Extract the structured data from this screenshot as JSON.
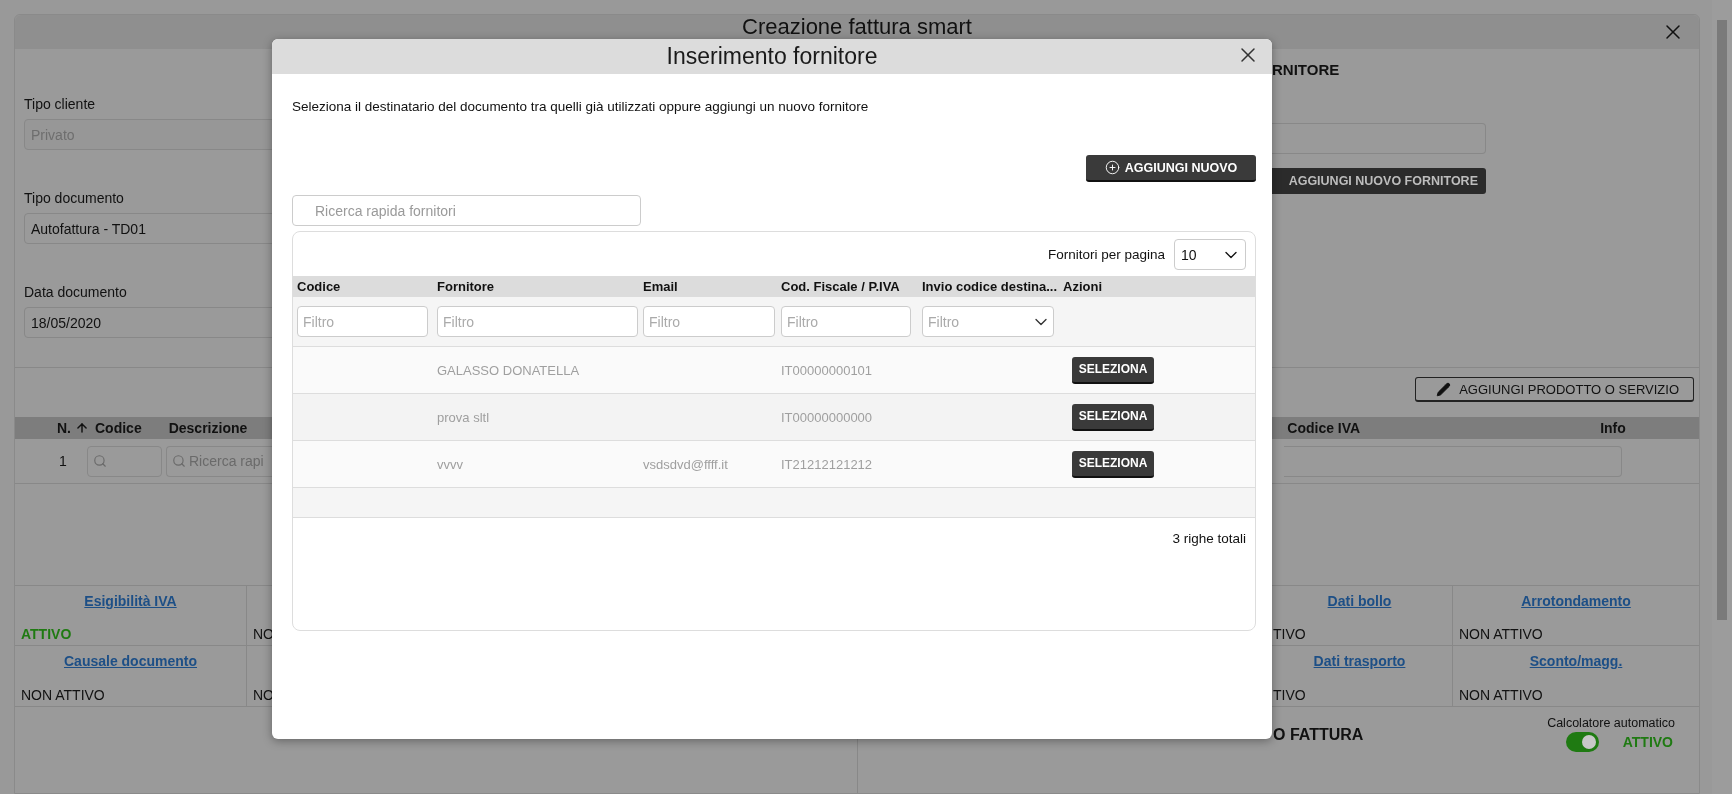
{
  "page": {
    "title": "Creazione fattura smart",
    "section_heading": "RNITORE",
    "fields": [
      {
        "label": "Tipo cliente",
        "value": "Privato",
        "disabled": true
      },
      {
        "label": "Tipo documento",
        "value": "Autofattura - TD01",
        "disabled": false
      },
      {
        "label": "Data documento",
        "value": "18/05/2020",
        "disabled": false
      }
    ],
    "add_supplier_button": "AGGIUNGI NUOVO FORNITORE",
    "add_product_button": "AGGIUNGI PRODOTTO O SERVIZIO",
    "lines_table": {
      "columns_left": [
        "N.",
        "Codice",
        "Descrizione"
      ],
      "columns_right": [
        "Codice IVA",
        "Info"
      ],
      "rows": [
        {
          "number": "1",
          "description_placeholder": "Ricerca rapi"
        }
      ]
    },
    "options": [
      [
        {
          "title": "Esigibilità IVA",
          "status": "ATTIVO",
          "active": true
        },
        {
          "status": "NO",
          "active": false
        },
        {
          "title": "Dati bollo",
          "status": "TIVO",
          "active": false
        },
        {
          "title": "Arrotondamento",
          "status": "NON ATTIVO",
          "active": false
        }
      ],
      [
        {
          "title": "Causale documento",
          "status": "NON ATTIVO",
          "active": false
        },
        {
          "status": "NO",
          "active": false
        },
        {
          "title": "Dati trasporto",
          "status": "TIVO",
          "active": false
        },
        {
          "title": "Sconto/magg.",
          "status": "NON ATTIVO",
          "active": false
        }
      ]
    ],
    "summary_heading": "O FATTURA",
    "calculator": {
      "label": "Calcolatore automatico",
      "on": true,
      "status": "ATTIVO"
    }
  },
  "modal": {
    "title": "Inserimento fornitore",
    "intro": "Seleziona il destinatario del documento tra quelli già utilizzati oppure aggiungi un nuovo fornitore",
    "add_button": "AGGIUNGI NUOVO",
    "search_placeholder": "Ricerca rapida fornitori",
    "page_size_label": "Fornitori per pagina",
    "page_size": "10",
    "columns": [
      "Codice",
      "Fornitore",
      "Email",
      "Cod. Fiscale / P.IVA",
      "Invio codice destina...",
      "Azioni"
    ],
    "filters": [
      {
        "kind": "text",
        "placeholder": "Filtro"
      },
      {
        "kind": "text",
        "placeholder": "Filtro"
      },
      {
        "kind": "text",
        "placeholder": "Filtro"
      },
      {
        "kind": "text",
        "placeholder": "Filtro"
      },
      {
        "kind": "select",
        "placeholder": "Filtro"
      }
    ],
    "rows": [
      {
        "supplier": "GALASSO DONATELLA",
        "tax_id": "IT00000000101",
        "action": "SELEZIONA"
      },
      {
        "supplier": "prova sltl",
        "tax_id": "IT00000000000",
        "action": "SELEZIONA"
      },
      {
        "supplier": "vvvv",
        "email": "vsdsdvd@ffff.it",
        "tax_id": "IT21212121212",
        "action": "SELEZIONA"
      }
    ],
    "total": "3 righe totali"
  }
}
